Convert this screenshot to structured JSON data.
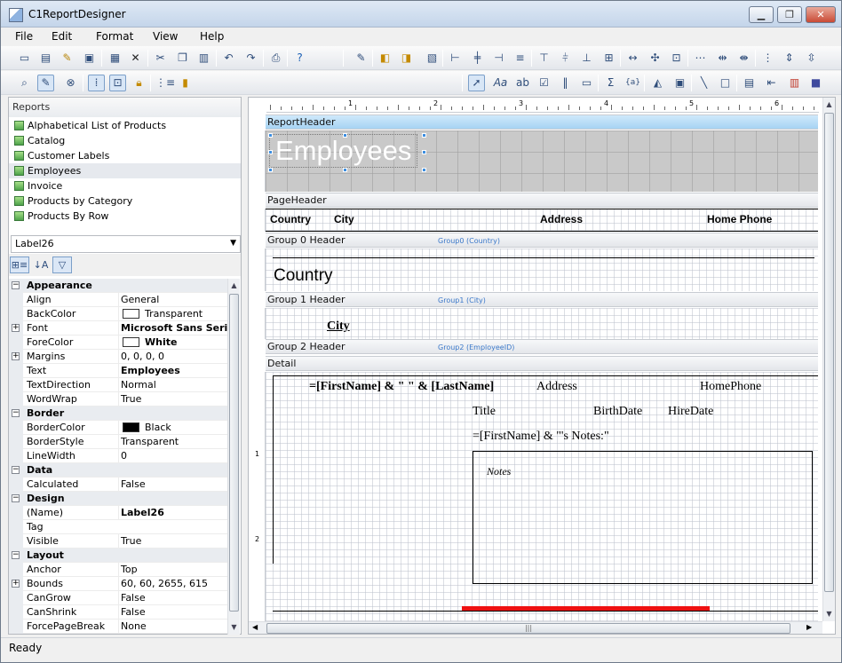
{
  "window": {
    "title": "C1ReportDesigner",
    "minimize": "▁",
    "restore": "❐",
    "close": "✕"
  },
  "menu": [
    "File",
    "Edit",
    "Format",
    "View",
    "Help"
  ],
  "toolbar1": [
    "new-icon",
    "open-icon",
    "wand-icon",
    "save-icon",
    "new-report-icon",
    "delete-icon",
    "cut-icon",
    "copy-icon",
    "paste-icon",
    "undo-icon",
    "redo-icon",
    "print-icon",
    "help-icon"
  ],
  "reports": {
    "heading": "Reports",
    "items": [
      "Alphabetical List of Products",
      "Catalog",
      "Customer Labels",
      "Employees",
      "Invoice",
      "Products by Category",
      "Products By Row"
    ],
    "selected": "Employees"
  },
  "object_combo": {
    "value": "Label26"
  },
  "properties": [
    {
      "cat": "Appearance"
    },
    {
      "name": "Align",
      "value": "General"
    },
    {
      "name": "BackColor",
      "value": "Transparent",
      "swatch": "#ffffff"
    },
    {
      "name": "Font",
      "value": "Microsoft Sans Serif,",
      "bold": true,
      "expand": true
    },
    {
      "name": "ForeColor",
      "value": "White",
      "swatch": "#ffffff",
      "bold": true
    },
    {
      "name": "Margins",
      "value": "0, 0, 0, 0",
      "expand": true
    },
    {
      "name": "Text",
      "value": "Employees",
      "bold": true
    },
    {
      "name": "TextDirection",
      "value": "Normal"
    },
    {
      "name": "WordWrap",
      "value": "True"
    },
    {
      "cat": "Border"
    },
    {
      "name": "BorderColor",
      "value": "Black",
      "swatch": "#000000"
    },
    {
      "name": "BorderStyle",
      "value": "Transparent"
    },
    {
      "name": "LineWidth",
      "value": "0"
    },
    {
      "cat": "Data"
    },
    {
      "name": "Calculated",
      "value": "False"
    },
    {
      "cat": "Design"
    },
    {
      "name": "(Name)",
      "value": "Label26",
      "bold": true
    },
    {
      "name": "Tag",
      "value": ""
    },
    {
      "name": "Visible",
      "value": "True"
    },
    {
      "cat": "Layout"
    },
    {
      "name": "Anchor",
      "value": "Top"
    },
    {
      "name": "Bounds",
      "value": "60, 60, 2655, 615",
      "expand": true
    },
    {
      "name": "CanGrow",
      "value": "False"
    },
    {
      "name": "CanShrink",
      "value": "False"
    },
    {
      "name": "ForcePageBreak",
      "value": "None"
    }
  ],
  "ruler": {
    "numbers": [
      "1",
      "2",
      "3",
      "4",
      "5",
      "6"
    ],
    "vnumbers": [
      "1",
      "2"
    ]
  },
  "sections": {
    "report_header": "ReportHeader",
    "page_header": "PageHeader",
    "group0": "Group 0 Header",
    "group0_sub": "Group0 (Country)",
    "group1": "Group 1 Header",
    "group1_sub": "Group1 (City)",
    "group2": "Group 2 Header",
    "group2_sub": "Group2 (EmployeeID)",
    "detail": "Detail"
  },
  "fields": {
    "title": "Employees",
    "col_country": "Country",
    "col_city": "City",
    "col_address": "Address",
    "col_phone": "Home Phone",
    "group_country": "Country",
    "group_city": "City",
    "name_expr": "=[FirstName] & \" \" & [LastName]",
    "address": "Address",
    "homephone": "HomePhone",
    "title_field": "Title",
    "birthdate": "BirthDate",
    "hiredate": "HireDate",
    "notes_expr": "=[FirstName] & \"'s Notes:\"",
    "notes": "Notes"
  },
  "status": "Ready",
  "colors": {
    "accent_red": "#ee1111",
    "header_band": "#c9c9c9",
    "selection_handle": "#3d8ee0"
  }
}
